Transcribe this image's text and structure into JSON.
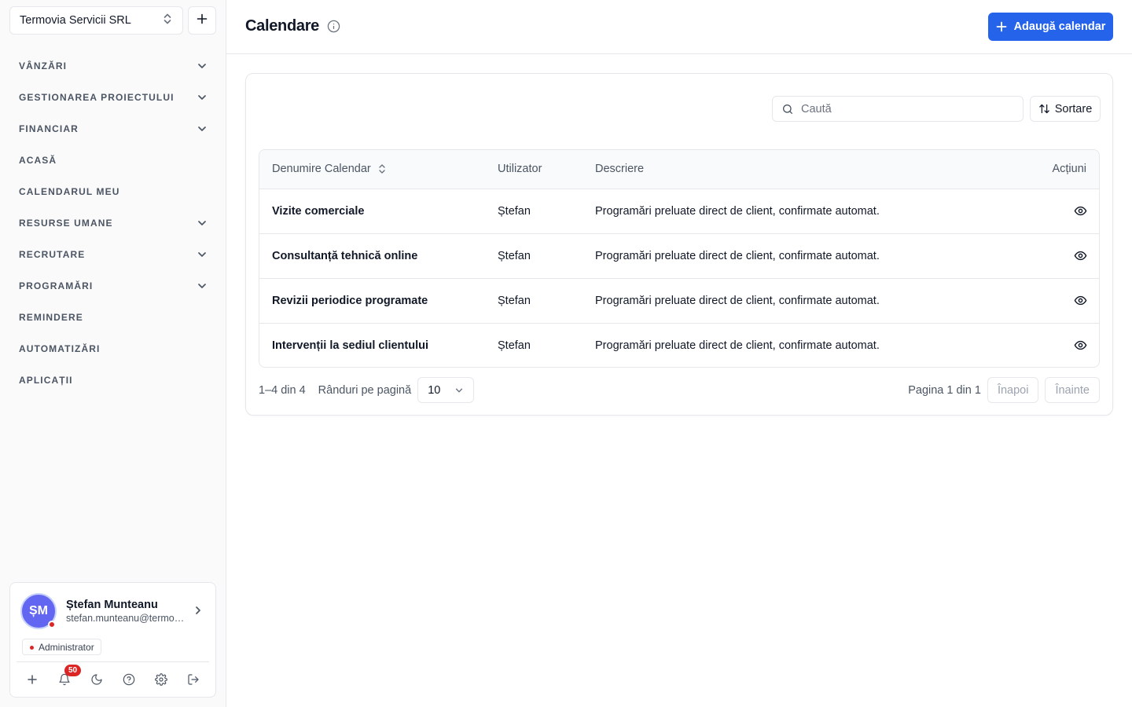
{
  "sidebar": {
    "org_name": "Termovia Servicii SRL",
    "nav": [
      {
        "label": "VÂNZĂRI",
        "expandable": true
      },
      {
        "label": "GESTIONAREA PROIECTULUI",
        "expandable": true
      },
      {
        "label": "FINANCIAR",
        "expandable": true
      },
      {
        "label": "ACASĂ",
        "expandable": false
      },
      {
        "label": "CALENDARUL MEU",
        "expandable": false
      },
      {
        "label": "RESURSE UMANE",
        "expandable": true
      },
      {
        "label": "RECRUTARE",
        "expandable": true
      },
      {
        "label": "PROGRAMĂRI",
        "expandable": true
      },
      {
        "label": "REMINDERE",
        "expandable": false
      },
      {
        "label": "AUTOMATIZĂRI",
        "expandable": false
      },
      {
        "label": "APLICAȚII",
        "expandable": false
      }
    ],
    "user": {
      "initials": "ȘM",
      "name": "Ștefan Munteanu",
      "email": "stefan.munteanu@termovia.ro",
      "role": "Administrator",
      "notifications": "50"
    }
  },
  "header": {
    "title": "Calendare",
    "add_button": "Adaugă calendar"
  },
  "toolbar": {
    "search_placeholder": "Caută",
    "sort_label": "Sortare"
  },
  "table": {
    "columns": [
      "Denumire Calendar",
      "Utilizator",
      "Descriere",
      "Acțiuni"
    ],
    "rows": [
      {
        "name": "Vizite comerciale",
        "user": "Ștefan",
        "description": "Programări preluate direct de client, confirmate automat."
      },
      {
        "name": "Consultanță tehnică online",
        "user": "Ștefan",
        "description": "Programări preluate direct de client, confirmate automat."
      },
      {
        "name": "Revizii periodice programate",
        "user": "Ștefan",
        "description": "Programări preluate direct de client, confirmate automat."
      },
      {
        "name": "Intervenții la sediul clientului",
        "user": "Ștefan",
        "description": "Programări preluate direct de client, confirmate automat."
      }
    ]
  },
  "pagination": {
    "range": "1–4 din 4",
    "rows_label": "Rânduri pe pagină",
    "rows_value": "10",
    "page_text": "Pagina 1 din 1",
    "prev": "Înapoi",
    "next": "Înainte"
  },
  "colors": {
    "accent": "#2563eb",
    "avatar": "#6366f1",
    "badge": "#dc2626"
  }
}
